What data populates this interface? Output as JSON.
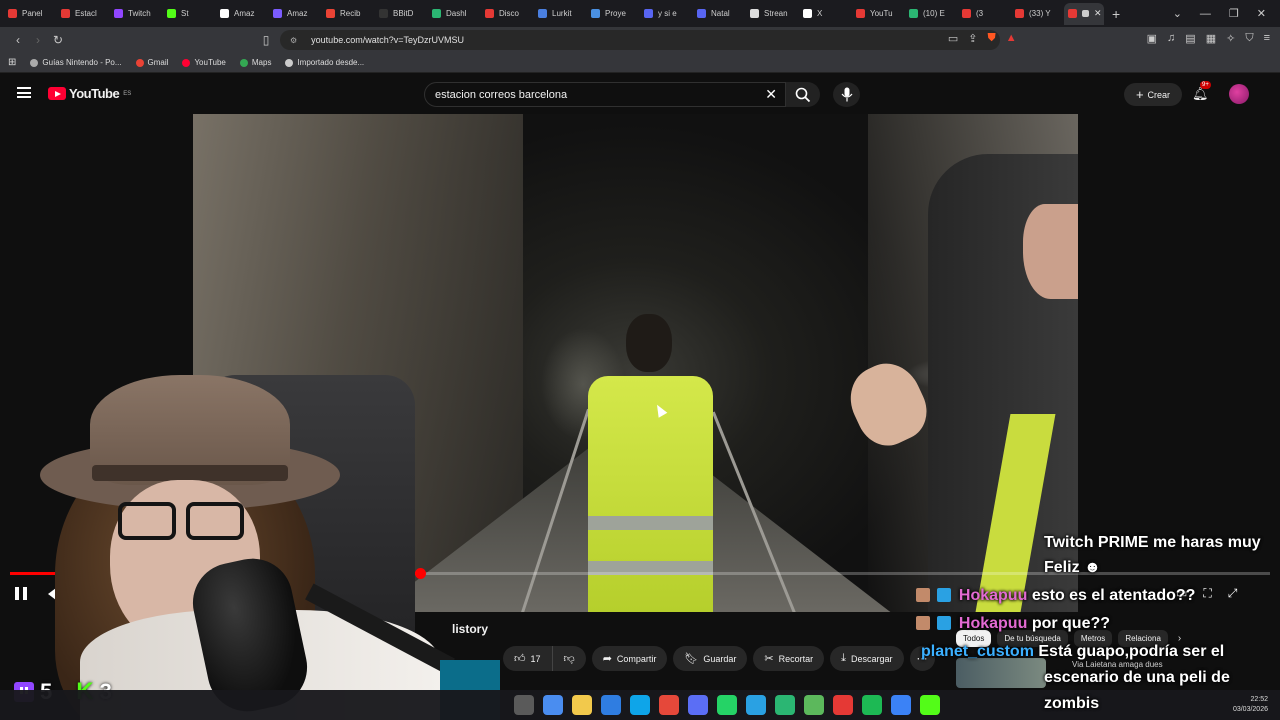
{
  "browser": {
    "tabs": [
      {
        "label": "Panel",
        "color": "#e53935"
      },
      {
        "label": "Estacl",
        "color": "#e53935"
      },
      {
        "label": "Twitch",
        "color": "#9146ff"
      },
      {
        "label": "St",
        "color": "#53fc18"
      },
      {
        "label": "Amaz",
        "color": "#ffffff"
      },
      {
        "label": "Amaz",
        "color": "#7b5cff"
      },
      {
        "label": "Recib",
        "color": "#ea4335"
      },
      {
        "label": "BBitD",
        "color": "#333333"
      },
      {
        "label": "Dashl",
        "color": "#2bb673"
      },
      {
        "label": "Disco",
        "color": "#e53935"
      },
      {
        "label": "Lurkit",
        "color": "#4a7fe0"
      },
      {
        "label": "Proye",
        "color": "#4a90e2"
      },
      {
        "label": "y si e",
        "color": "#5865f2"
      },
      {
        "label": "Natal",
        "color": "#5865f2"
      },
      {
        "label": "Strean",
        "color": "#dddddd"
      },
      {
        "label": "X",
        "color": "#ffffff"
      },
      {
        "label": "YouTu",
        "color": "#e53935"
      },
      {
        "label": "(10) E",
        "color": "#2bb673"
      },
      {
        "label": "(3",
        "color": "#e53935"
      },
      {
        "label": "(33) Y",
        "color": "#e53935"
      }
    ],
    "active_tab_color": "#e53935",
    "url": "youtube.com/watch?v=TeyDzrUVMSU",
    "bookmarks": [
      {
        "label": "Guías Nintendo - Po...",
        "color": "#aaaaaa"
      },
      {
        "label": "Gmail",
        "color": "#ea4335"
      },
      {
        "label": "YouTube",
        "color": "#ff0033"
      },
      {
        "label": "Maps",
        "color": "#34a853"
      },
      {
        "label": "Importado desde...",
        "color": "#cccccc"
      }
    ]
  },
  "youtube": {
    "logo_text": "YouTube",
    "region": "ES",
    "search_query": "estacion correos barcelona",
    "create_label": "Crear",
    "notif_count": "9+",
    "video": {
      "progress_fraction": 0.325,
      "history_text": "listory"
    },
    "actions": {
      "likes": "17",
      "share": "Compartir",
      "save": "Guardar",
      "clip": "Recortar",
      "download": "Descargar"
    },
    "chips": [
      "Todos",
      "De tu búsqueda",
      "Metros",
      "Relaciona"
    ],
    "related_title": "Via Laietana amaga dues"
  },
  "stream": {
    "twitch_count": "5",
    "kick_count": "3"
  },
  "chat": [
    {
      "user": "",
      "text": "Twitch PRIME me haras muy",
      "color": "#ffffff"
    },
    {
      "user": "",
      "text": "Feliz",
      "color": "#ffffff"
    },
    {
      "user": "Hokapuu",
      "text": "esto es el atentado??",
      "color": "#e26ad2"
    },
    {
      "user": "Hokapuu",
      "text": "por que??",
      "color": "#e26ad2"
    },
    {
      "user": "planet_custom",
      "text": "Está guapo,podría ser el",
      "color": "#3bb0ff"
    },
    {
      "user": "",
      "text": "escenario de una peli de",
      "color": "#ffffff"
    },
    {
      "user": "",
      "text": "zombis",
      "color": "#ffffff"
    }
  ],
  "taskbar": {
    "time": "22:52",
    "date": "03/03/2026",
    "icon_colors": [
      "#5a5a5a",
      "#4a8df0",
      "#f2c94c",
      "#2f7de1",
      "#0ea5e9",
      "#e5483a",
      "#5b6ef5",
      "#25d366",
      "#2aa1e3",
      "#2bb673",
      "#5cb85c",
      "#e53935",
      "#1db954",
      "#3b82f6",
      "#53fc18"
    ]
  }
}
